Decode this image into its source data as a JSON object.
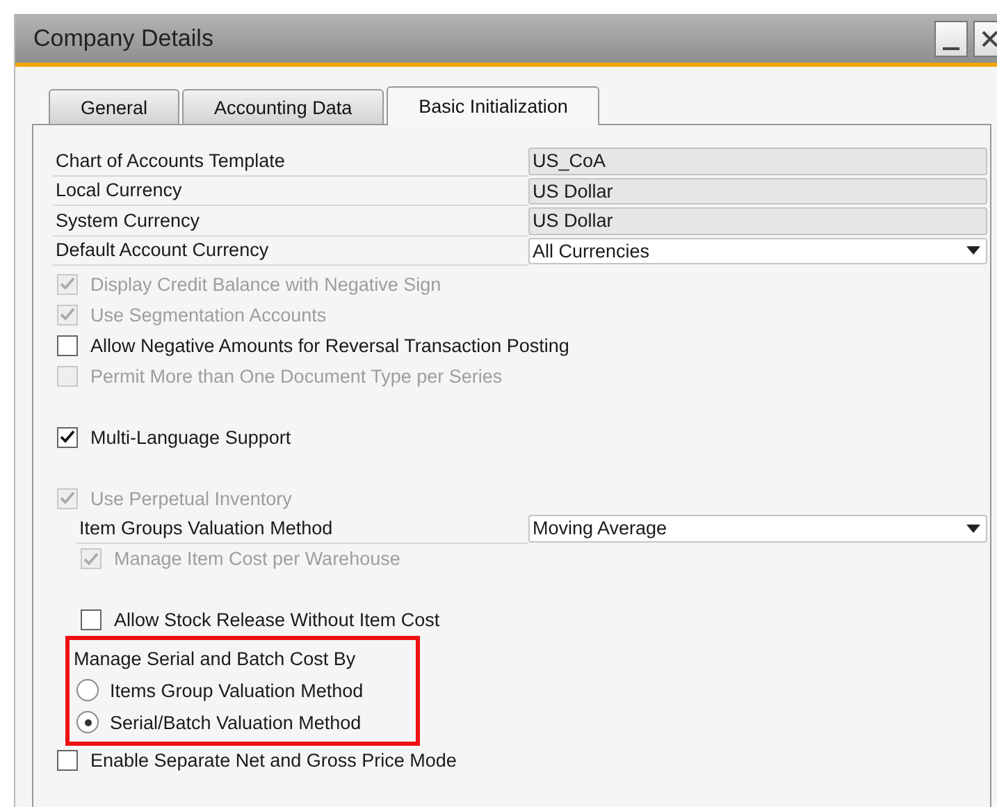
{
  "window": {
    "title": "Company Details"
  },
  "tabs": [
    {
      "label": "General",
      "selected": false
    },
    {
      "label": "Accounting Data",
      "selected": false
    },
    {
      "label": "Basic Initialization",
      "selected": true
    }
  ],
  "fields": [
    {
      "label": "Chart of Accounts Template",
      "value": "US_CoA",
      "kind": "readonly"
    },
    {
      "label": "Local Currency",
      "value": "US Dollar",
      "kind": "readonly"
    },
    {
      "label": "System Currency",
      "value": "US Dollar",
      "kind": "readonly"
    },
    {
      "label": "Default Account Currency",
      "value": "All Currencies",
      "kind": "dropdown"
    }
  ],
  "option_groups": [
    [
      {
        "kind": "checkbox",
        "label": "Display Credit Balance with Negative Sign",
        "checked": true,
        "disabled": true
      },
      {
        "kind": "checkbox",
        "label": "Use Segmentation Accounts",
        "checked": true,
        "disabled": true
      },
      {
        "kind": "checkbox",
        "label": "Allow Negative Amounts for Reversal Transaction Posting",
        "checked": false,
        "disabled": false
      },
      {
        "kind": "checkbox",
        "label": "Permit More than One Document Type per Series",
        "checked": false,
        "disabled": true
      }
    ],
    [
      {
        "kind": "checkbox",
        "label": "Multi-Language Support",
        "checked": true,
        "disabled": false
      }
    ],
    [
      {
        "kind": "checkbox",
        "label": "Use Perpetual Inventory",
        "checked": true,
        "disabled": true,
        "children": [
          [
            {
              "kind": "field",
              "label": "Item Groups Valuation Method",
              "value": "Moving Average"
            },
            {
              "kind": "checkbox",
              "label": "Manage Item Cost per Warehouse",
              "checked": true,
              "disabled": true
            }
          ],
          [
            {
              "kind": "checkbox",
              "label": "Allow Stock Release Without Item Cost",
              "checked": false,
              "disabled": false
            },
            {
              "kind": "radio_group",
              "title": "Manage Serial and Batch Cost By",
              "highlighted": true,
              "options": [
                {
                  "label": "Items Group Valuation Method",
                  "selected": false
                },
                {
                  "label": "Serial/Batch Valuation Method",
                  "selected": true
                }
              ]
            }
          ]
        ]
      },
      {
        "kind": "checkbox",
        "label": "Enable Separate Net and Gross Price Mode",
        "checked": false,
        "disabled": false
      }
    ]
  ]
}
